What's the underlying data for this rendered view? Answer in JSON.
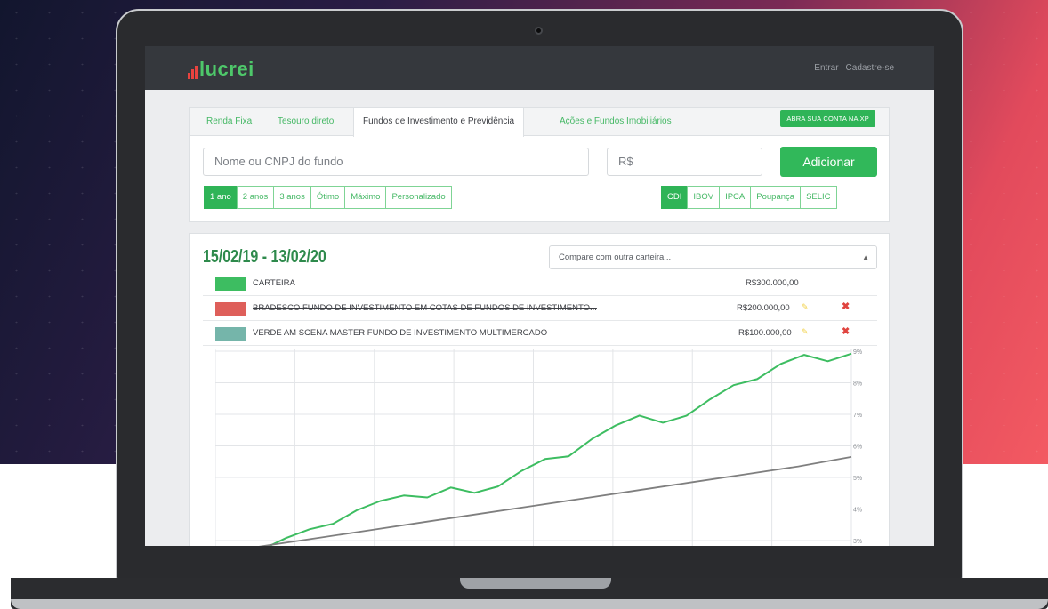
{
  "app": {
    "brand": "lucrei",
    "nav": {
      "login": "Entrar",
      "signup": "Cadastre-se"
    }
  },
  "tabs": [
    {
      "label": "Renda Fixa",
      "active": false
    },
    {
      "label": "Tesouro direto",
      "active": false
    },
    {
      "label": "Fundos de Investimento e Previdência",
      "active": true
    },
    {
      "label": "Ações e Fundos Imobiliários",
      "active": false
    }
  ],
  "xp_button": "ABRA SUA CONTA NA XP",
  "search": {
    "fund_placeholder": "Nome ou CNPJ do fundo",
    "amount_placeholder": "R$",
    "add_label": "Adicionar"
  },
  "periods": [
    {
      "label": "1 ano",
      "active": true
    },
    {
      "label": "2 anos",
      "active": false
    },
    {
      "label": "3 anos",
      "active": false
    },
    {
      "label": "Ótimo",
      "active": false
    },
    {
      "label": "Máximo",
      "active": false
    },
    {
      "label": "Personalizado",
      "active": false
    }
  ],
  "benchmarks": [
    {
      "label": "CDI",
      "active": true
    },
    {
      "label": "IBOV",
      "active": false
    },
    {
      "label": "IPCA",
      "active": false
    },
    {
      "label": "Poupança",
      "active": false
    },
    {
      "label": "SELIC",
      "active": false
    }
  ],
  "summary": {
    "date_range": "15/02/19 - 13/02/20",
    "compare_placeholder": "Compare com outra carteira..."
  },
  "portfolio": [
    {
      "name": "CARTEIRA",
      "amount": "R$300.000,00",
      "color": "#3dbd61",
      "removed": false
    },
    {
      "name": "BRADESCO FUNDO DE INVESTIMENTO EM COTAS DE FUNDOS DE INVESTIMENTO...",
      "amount": "R$200.000,00",
      "color": "#de5f5a",
      "removed": true
    },
    {
      "name": "VERDE AM SCENA MASTER FUNDO DE INVESTIMENTO MULTIMERCADO",
      "amount": "R$100.000,00",
      "color": "#75b5aa",
      "removed": true
    }
  ],
  "chart_data": {
    "type": "line",
    "y_tick_labels": [
      "9%",
      "8%",
      "7%",
      "6%",
      "5%",
      "4%",
      "3%"
    ],
    "ylim": [
      3,
      9
    ],
    "grid": true,
    "series": [
      {
        "color": "#3dbd61",
        "values": [
          2.2,
          2.4,
          2.7,
          3.0,
          3.4,
          3.6,
          3.9,
          4.2,
          4.5,
          4.4,
          4.6,
          4.5,
          4.8,
          5.2,
          5.5,
          5.7,
          6.3,
          6.6,
          6.9,
          6.8,
          7.0,
          7.4,
          7.9,
          8.2,
          8.6,
          8.8,
          8.7,
          9.0
        ]
      },
      {
        "color": "#7f7f7f",
        "values": [
          2.6,
          2.85,
          3.1,
          3.35,
          3.6,
          3.85,
          4.1,
          4.35,
          4.6,
          4.85,
          5.1,
          5.35,
          5.65
        ]
      }
    ]
  }
}
